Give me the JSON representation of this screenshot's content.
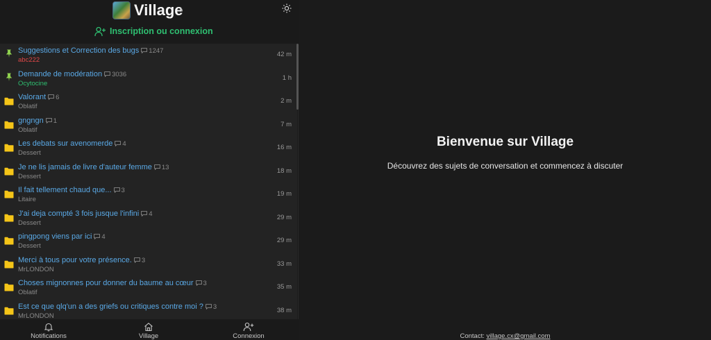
{
  "header": {
    "site_title": "Village",
    "login_label": "Inscription ou connexion"
  },
  "topics": [
    {
      "icon": "pin-icon",
      "title": "Suggestions et Correction des bugs",
      "count": "1247",
      "author": "abc222",
      "author_color": "#e04848",
      "time": "42 m"
    },
    {
      "icon": "pin-icon",
      "title": "Demande de modération",
      "count": "3036",
      "author": "Ocytocine",
      "author_color": "#2fbf71",
      "time": "1 h"
    },
    {
      "icon": "folder-icon",
      "title": "Valorant",
      "count": "6",
      "author": "Oblatif",
      "time": "2 m"
    },
    {
      "icon": "folder-icon",
      "title": "gngngn",
      "count": "1",
      "author": "Oblatif",
      "time": "7 m"
    },
    {
      "icon": "folder-icon",
      "title": "Les debats sur avenomerde",
      "count": "4",
      "author": "Dessert",
      "time": "16 m"
    },
    {
      "icon": "folder-icon",
      "title": "Je ne lis jamais de livre d'auteur femme",
      "count": "13",
      "author": "Dessert",
      "time": "18 m"
    },
    {
      "icon": "folder-icon",
      "title": "Il fait tellement chaud que...",
      "count": "3",
      "author": "Litaire",
      "time": "19 m"
    },
    {
      "icon": "folder-icon",
      "title": "J'ai deja compté 3 fois jusque l'infini",
      "count": "4",
      "author": "Dessert",
      "time": "29 m"
    },
    {
      "icon": "folder-icon",
      "title": "pingpong viens par ici",
      "count": "4",
      "author": "Dessert",
      "time": "29 m"
    },
    {
      "icon": "folder-icon",
      "title": "Merci à tous pour votre présence.",
      "count": "3",
      "author": "MrLONDON",
      "time": "33 m"
    },
    {
      "icon": "folder-icon",
      "title": "Choses mignonnes pour donner du baume au cœur",
      "count": "3",
      "author": "Oblatif",
      "time": "35 m"
    },
    {
      "icon": "folder-icon",
      "title": "Est ce que qlq'un a des griefs ou critiques contre moi ?",
      "count": "3",
      "author": "MrLONDON",
      "time": "38 m"
    }
  ],
  "nav": {
    "notifications": "Notifications",
    "village": "Village",
    "connexion": "Connexion"
  },
  "welcome": {
    "title": "Bienvenue sur Village",
    "subtitle": "Découvrez des sujets de conversation et commencez à discuter"
  },
  "footer": {
    "contact_label": "Contact:",
    "contact_email": "village.cx@gmail.com"
  },
  "colors": {
    "link_blue": "#5aa9e6",
    "accent_green": "#2fbf71",
    "pin_green": "#8fd14f",
    "folder_yellow": "#f5c518"
  }
}
